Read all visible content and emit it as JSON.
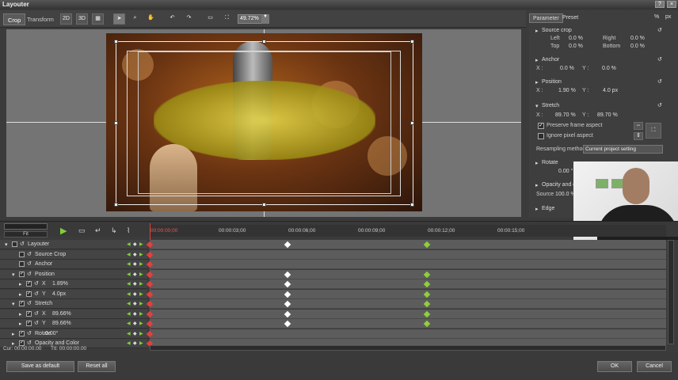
{
  "window": {
    "title": "Layouter"
  },
  "toolbar": {
    "tabs": [
      "Crop",
      "Transform"
    ],
    "btn_2d": "2D",
    "btn_3d": "3D",
    "zoom": "49.72%"
  },
  "right_panel": {
    "tabs": [
      "Parameter",
      "Preset"
    ],
    "unit_pct": "%",
    "unit_px": "px",
    "source_crop": {
      "title": "Source crop",
      "left_label": "Left",
      "left_value": "0.0 %",
      "right_label": "Right",
      "right_value": "0.0 %",
      "top_label": "Top",
      "top_value": "0.0 %",
      "bottom_label": "Bottom",
      "bottom_value": "0.0 %"
    },
    "anchor": {
      "title": "Anchor",
      "x_label": "X :",
      "x_value": "0.0 %",
      "y_label": "Y :",
      "y_value": "0.0 %"
    },
    "position": {
      "title": "Position",
      "x_label": "X :",
      "x_value": "1.90 %",
      "y_label": "Y :",
      "y_value": "4.0 px"
    },
    "stretch": {
      "title": "Stretch",
      "x_label": "X :",
      "x_value": "89.70 %",
      "y_label": "Y :",
      "y_value": "89.70 %"
    },
    "preserve_aspect": "Preserve frame aspect",
    "ignore_pixel": "Ignore pixel aspect",
    "resampling_label": "Resampling method",
    "resampling_value": "Current project setting",
    "rotate": {
      "title": "Rotate",
      "value": "0.00 °"
    },
    "opacity": {
      "title": "Opacity and c",
      "source_label": "Source",
      "source_value": "100.0 %"
    },
    "edge": {
      "title": "Edge"
    }
  },
  "timeline": {
    "fit_label": "Fit",
    "ruler": [
      "00:00:00;00",
      "00:00:03;00",
      "00:00:06;00",
      "00:00:09;00",
      "00:00:12;00",
      "00:00:15;00"
    ],
    "tracks": [
      {
        "label": "Layouter",
        "value": ""
      },
      {
        "label": "Source Crop",
        "value": ""
      },
      {
        "label": "Anchor",
        "value": ""
      },
      {
        "label": "Position",
        "value": ""
      },
      {
        "label": "X",
        "value": "1.89%"
      },
      {
        "label": "Y",
        "value": "4.0px"
      },
      {
        "label": "Stretch",
        "value": ""
      },
      {
        "label": "X",
        "value": "89.66%"
      },
      {
        "label": "Y",
        "value": "89.66%"
      },
      {
        "label": "Rotate",
        "value": "0.00°"
      },
      {
        "label": "Opacity and Color",
        "value": ""
      }
    ],
    "cur_label": "Cur: 00:00:00.00",
    "ttl_label": "Ttl: 00:00:00.00"
  },
  "buttons": {
    "save_default": "Save as default",
    "reset_all": "Reset all",
    "ok": "OK",
    "cancel": "Cancel"
  }
}
